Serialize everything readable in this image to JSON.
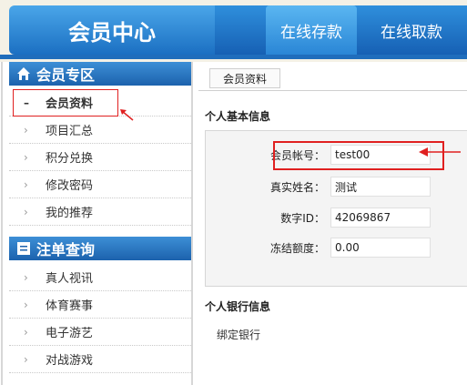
{
  "header": {
    "brand": "会员中心",
    "tabs": [
      {
        "label": "在线存款",
        "active": true
      },
      {
        "label": "在线取款",
        "active": false
      }
    ]
  },
  "sidebar": {
    "section1": {
      "title": "会员专区",
      "icon": "home-icon",
      "items": [
        {
          "label": "会员资料",
          "marker": "–",
          "active": true
        },
        {
          "label": "项目汇总",
          "marker": "›",
          "active": false
        },
        {
          "label": "积分兑换",
          "marker": "›",
          "active": false
        },
        {
          "label": "修改密码",
          "marker": "›",
          "active": false
        },
        {
          "label": "我的推荐",
          "marker": "›",
          "active": false
        }
      ]
    },
    "section2": {
      "title": "注单查询",
      "icon": "list-icon",
      "items": [
        {
          "label": "真人视讯",
          "marker": "›"
        },
        {
          "label": "体育赛事",
          "marker": "›"
        },
        {
          "label": "电子游艺",
          "marker": "›"
        },
        {
          "label": "对战游戏",
          "marker": "›"
        }
      ]
    }
  },
  "main": {
    "tab_label": "会员资料",
    "basic_info_title": "个人基本信息",
    "fields": [
      {
        "label": "会员帐号：",
        "value": "test00"
      },
      {
        "label": "真实姓名：",
        "value": "测试"
      },
      {
        "label": "数字ID：",
        "value": "42069867"
      },
      {
        "label": "冻结额度：",
        "value": "0.00"
      }
    ],
    "bank_info_title": "个人银行信息",
    "bank_label": "绑定银行"
  },
  "colors": {
    "accent_blue": "#1f6dbc",
    "annotation_red": "#e02020"
  }
}
